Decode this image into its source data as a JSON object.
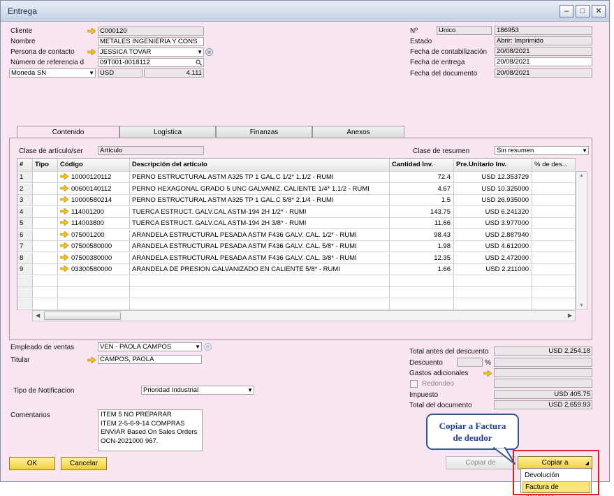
{
  "window": {
    "title": "Entrega",
    "min_glyph": "–",
    "max_glyph": "□",
    "close_glyph": "✕"
  },
  "header_left": {
    "cliente_label": "Cliente",
    "cliente_value": "C000120",
    "nombre_label": "Nombre",
    "nombre_value": "METALES INGENIERIA Y CONS",
    "contacto_label": "Persona de contacto",
    "contacto_value": "JESSICA TOVAR",
    "referencia_label": "Número de referencia d",
    "referencia_value": "09T001-0018112",
    "moneda_label": "Moneda SN",
    "moneda_currency": "USD",
    "moneda_rate": "4.111"
  },
  "header_right": {
    "numero_label": "Nº",
    "numero_series": "Unico",
    "numero_value": "186953",
    "estado_label": "Estado",
    "estado_value": "Abrir: Imprimido",
    "fecha_cont_label": "Fecha de contabilización",
    "fecha_cont_value": "20/08/2021",
    "fecha_entrega_label": "Fecha de entrega",
    "fecha_entrega_value": "20/08/2021",
    "fecha_doc_label": "Fecha del documento",
    "fecha_doc_value": "20/08/2021"
  },
  "tabs": [
    "Contenido",
    "Logística",
    "Finanzas",
    "Anexos"
  ],
  "content": {
    "clase_label": "Clase de artículo/ser",
    "clase_value": "Artículo",
    "resumen_label": "Clase de resumen",
    "resumen_value": "Sin resumen"
  },
  "grid": {
    "headers": [
      "#",
      "Tipo",
      "Código",
      "Descripción del artículo",
      "Cantidad Inv.",
      "Pre.Unitario Inv.",
      "% de des..."
    ],
    "rows": [
      {
        "n": "1",
        "code": "10000120112",
        "desc": "PERNO ESTRUCTURAL  ASTM A325 TP 1 GAL.C 1/2* 1.1/2 - RUMI",
        "qty": "72.4",
        "price": "USD 12.353729"
      },
      {
        "n": "2",
        "code": "00600140112",
        "desc": "PERNO HEXAGONAL GRADO 5 UNC GALVANIZ. CALIENTE 1/4* 1.1/2 - RUMI",
        "qty": "4.67",
        "price": "USD 10.325000"
      },
      {
        "n": "3",
        "code": "10000580214",
        "desc": "PERNO ESTRUCTURAL  ASTM A325 TP 1 GAL.C 5/8* 2.1/4 - RUMI",
        "qty": "1.5",
        "price": "USD 26.935000"
      },
      {
        "n": "4",
        "code": "114001200",
        "desc": "TUERCA ESTRUCT.  GALV.CAL  ASTM-194 2H 1/2* - RUMI",
        "qty": "143.75",
        "price": "USD 6.241320"
      },
      {
        "n": "5",
        "code": "114003800",
        "desc": "TUERCA ESTRUCT.  GALV.CAL  ASTM-194 2H 3/8* - RUMI",
        "qty": "11.66",
        "price": "USD 3.977000"
      },
      {
        "n": "6",
        "code": "075001200",
        "desc": "ARANDELA ESTRUCTURAL PESADA ASTM  F436  GALV.  CAL. 1/2* - RUMI",
        "qty": "98.43",
        "price": "USD 2.887940"
      },
      {
        "n": "7",
        "code": "07500580000",
        "desc": "ARANDELA ESTRUCTURAL PESADA ASTM  F436  GALV.  CAL. 5/8* - RUMI",
        "qty": "1.98",
        "price": "USD 4.612000"
      },
      {
        "n": "8",
        "code": "07500380000",
        "desc": "ARANDELA ESTRUCTURAL PESADA ASTM  F436  GALV.  CAL. 3/8* - RUMI",
        "qty": "12.35",
        "price": "USD 2.472000"
      },
      {
        "n": "9",
        "code": "03300580000",
        "desc": "ARANDELA DE PRESION GALVANIZADO EN CALIENTE 5/8* - RUMI",
        "qty": "1.66",
        "price": "USD 2.211000"
      }
    ]
  },
  "footer_left": {
    "empleado_label": "Empleado de ventas",
    "empleado_value": "VEN - PAOLA CAMPOS",
    "titular_label": "Titular",
    "titular_value": "CAMPOS, PAOLA",
    "notificacion_label": "Tipo de Notificacion",
    "notificacion_value": "Prioridad Industrial",
    "comentarios_label": "Comentarios",
    "comentarios_lines": [
      "ITEM 5 NO PREPARAR",
      "ITEM 2-5-6-9-14 COMPRAS",
      "ENVIAR Based On Sales Orders",
      "OCN-2021000 967."
    ]
  },
  "totals": {
    "antes_label": "Total antes del descuento",
    "antes_value": "USD 2,254.18",
    "descuento_label": "Descuento",
    "percent_sign": "%",
    "gastos_label": "Gastos adicionales",
    "redondeo_label": "Redondeo",
    "impuesto_label": "Impuesto",
    "impuesto_value": "USD 405.75",
    "total_label": "Total del documento",
    "total_value": "USD 2,659.93"
  },
  "buttons": {
    "ok": "OK",
    "cancel": "Cancelar",
    "copy_from": "Copiar de",
    "copy_to": "Copiar a"
  },
  "copy_to_menu": [
    "Devolución",
    "Factura de deudores"
  ],
  "callout": {
    "line1": "Copiar a Factura",
    "line2": "de deudor"
  },
  "colors": {
    "window_bg": "#f9e6f2",
    "button_gold": "#f1cf3a",
    "callout_blue": "#2f5597",
    "highlight_red": "#e01f25"
  }
}
